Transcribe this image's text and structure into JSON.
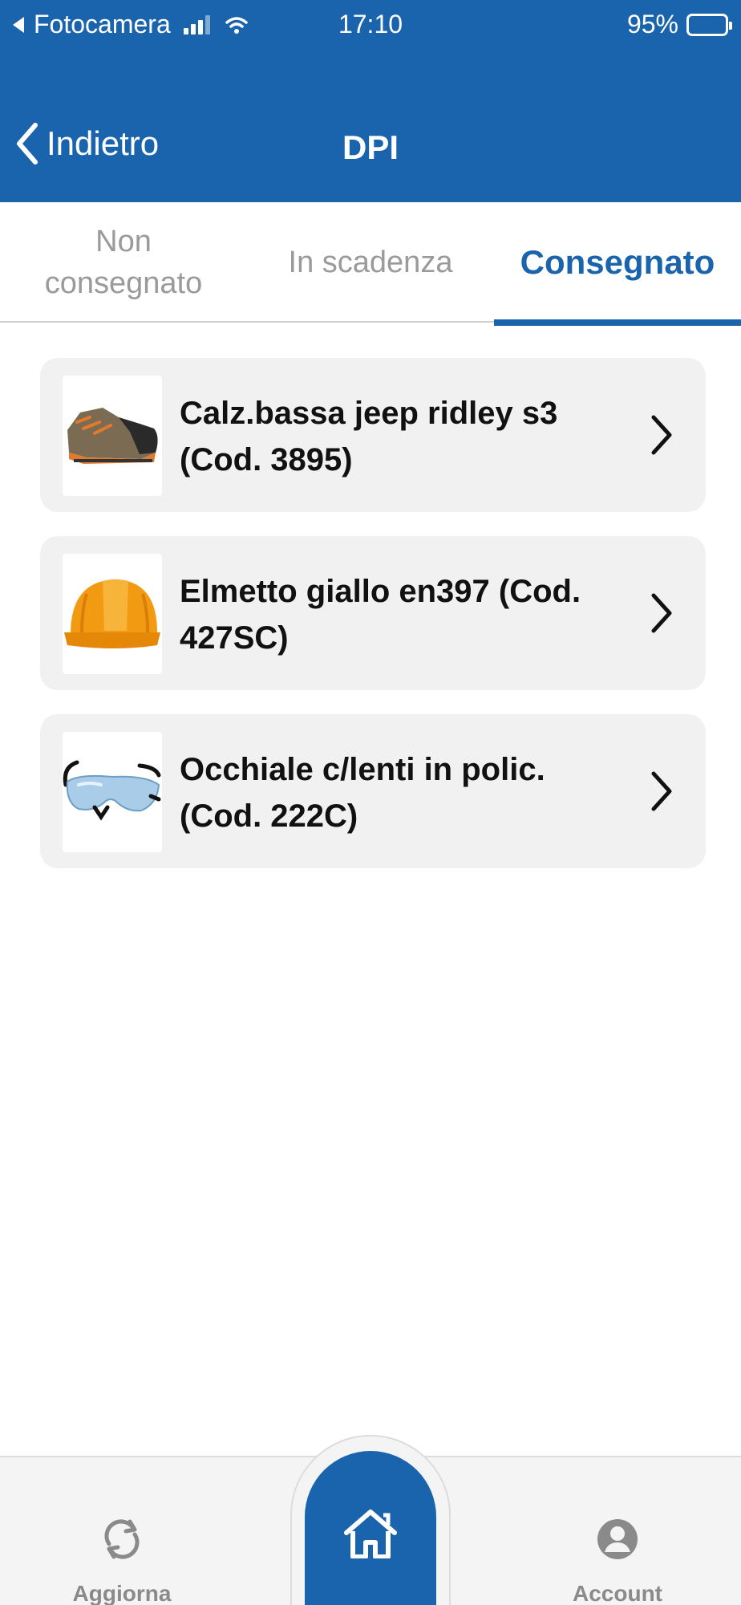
{
  "status_bar": {
    "back_app": "Fotocamera",
    "time": "17:10",
    "battery_percent": "95%",
    "battery_level": 0.95,
    "signal_icon": "cellular-signal-icon",
    "wifi_icon": "wifi-icon"
  },
  "nav": {
    "back_label": "Indietro",
    "title": "DPI"
  },
  "tabs": [
    {
      "label": "Non consegnato",
      "active": false
    },
    {
      "label": "In scadenza",
      "active": false
    },
    {
      "label": "Consegnato",
      "active": true
    }
  ],
  "items": [
    {
      "name": "Calz.bassa jeep ridley s3 (Cod. 3895)",
      "thumbnail": "safety-shoe"
    },
    {
      "name": "Elmetto giallo en397 (Cod. 427SC)",
      "thumbnail": "hard-hat"
    },
    {
      "name": "Occhiale c/lenti in polic. (Cod. 222C)",
      "thumbnail": "safety-glasses"
    }
  ],
  "bottom_nav": {
    "refresh_label": "Aggiorna",
    "home_icon": "home-icon",
    "account_label": "Account"
  },
  "colors": {
    "primary": "#1a64ad",
    "card_bg": "#f1f1f1",
    "inactive_text": "#9a9a9a"
  }
}
